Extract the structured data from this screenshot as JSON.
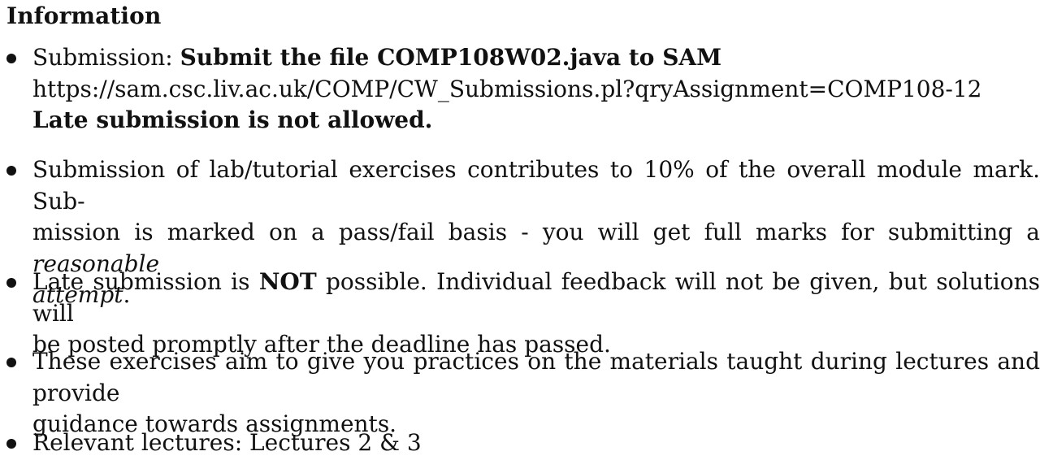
{
  "heading": "Information",
  "items": [
    {
      "lead": "Submission:",
      "bold_title": "Submit the file COMP108W02.java to SAM",
      "url": "https://sam.csc.liv.ac.uk/COMP/CW_Submissions.pl?qryAssignment=COMP108-12",
      "late_note": "Late submission is not allowed."
    },
    {
      "line1": "Submission of lab/tutorial exercises contributes to 10% of the overall module mark. Sub-",
      "line2_prefix": "mission is marked on a pass/fail basis - you will get full marks for submitting a",
      "line2_italic": "reasonable",
      "line3_italic": "attempt",
      "line3_suffix": "."
    },
    {
      "prefix": "Late submission is",
      "bold": "NOT",
      "suffix": "possible. Individual feedback will not be given, but solutions will",
      "line2": "be posted promptly after the deadline has passed."
    },
    {
      "line1": "These exercises aim to give you practices on the materials taught during lectures and provide",
      "line2": "guidance towards assignments."
    },
    {
      "text": "Relevant lectures: Lectures 2 & 3"
    }
  ]
}
